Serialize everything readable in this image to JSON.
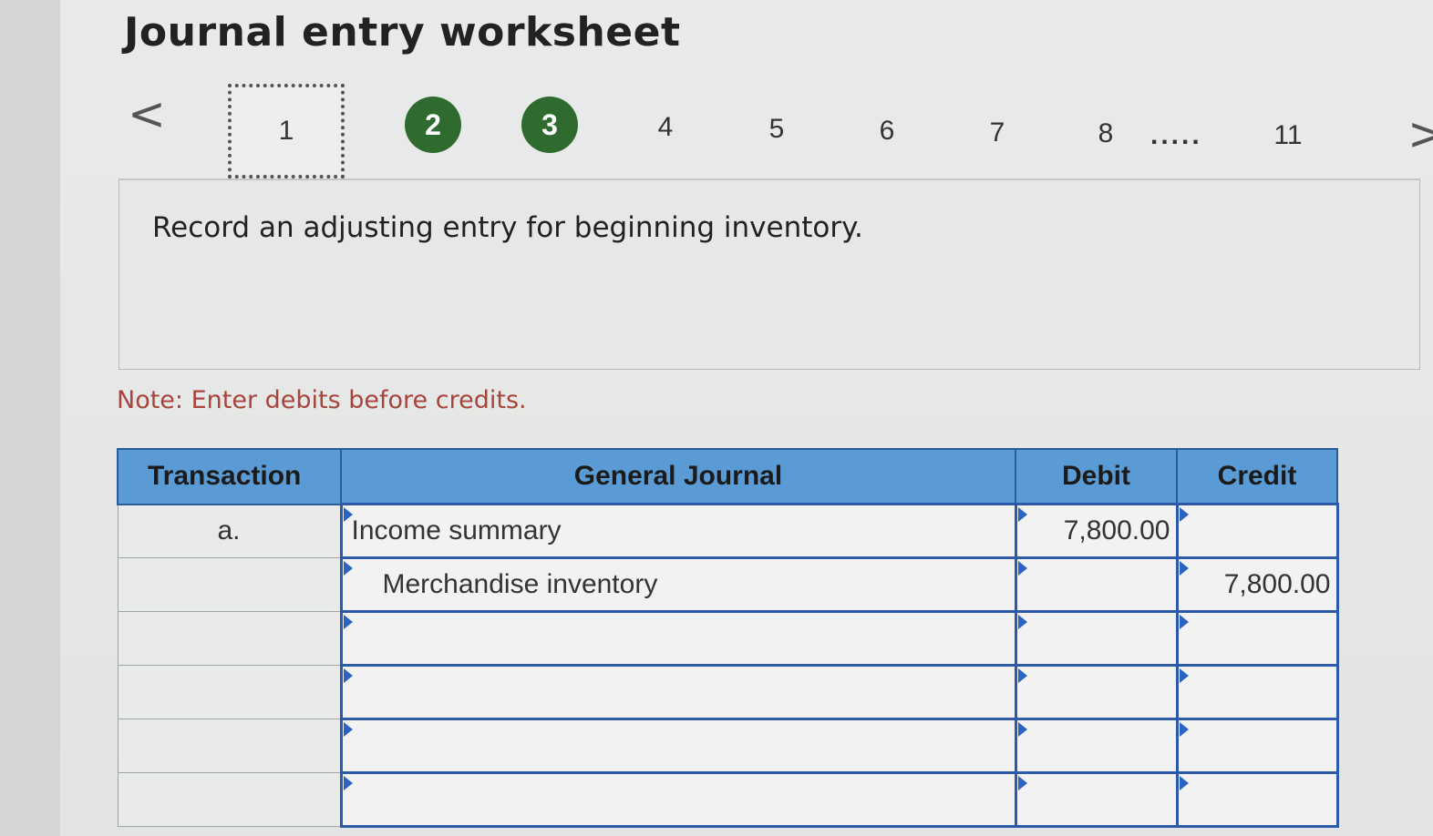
{
  "header": {
    "title": "Journal entry worksheet"
  },
  "navigation": {
    "prev_icon": "chevron-left-icon",
    "next_icon": "chevron-right-icon",
    "prev_glyph": "<",
    "next_glyph": ">",
    "current_step": "1",
    "completed_steps": [
      "2",
      "3"
    ],
    "steps": [
      "4",
      "5",
      "6",
      "7",
      "8"
    ],
    "ellipsis": ".....",
    "last_step": "11",
    "completed_color": "#2f6b2f"
  },
  "instruction": {
    "text": "Record an adjusting entry for beginning inventory."
  },
  "note": {
    "text": "Note: Enter debits before credits.",
    "color": "#a8443c"
  },
  "journal": {
    "header_color": "#5b9bd5",
    "columns": {
      "transaction": "Transaction",
      "general_journal": "General Journal",
      "debit": "Debit",
      "credit": "Credit"
    },
    "rows": [
      {
        "transaction": "a.",
        "account": "Income summary",
        "debit": "7,800.00",
        "credit": ""
      },
      {
        "transaction": "",
        "account": "Merchandise inventory",
        "debit": "",
        "credit": "7,800.00"
      },
      {
        "transaction": "",
        "account": "",
        "debit": "",
        "credit": ""
      },
      {
        "transaction": "",
        "account": "",
        "debit": "",
        "credit": ""
      },
      {
        "transaction": "",
        "account": "",
        "debit": "",
        "credit": ""
      },
      {
        "transaction": "",
        "account": "",
        "debit": "",
        "credit": ""
      }
    ]
  }
}
